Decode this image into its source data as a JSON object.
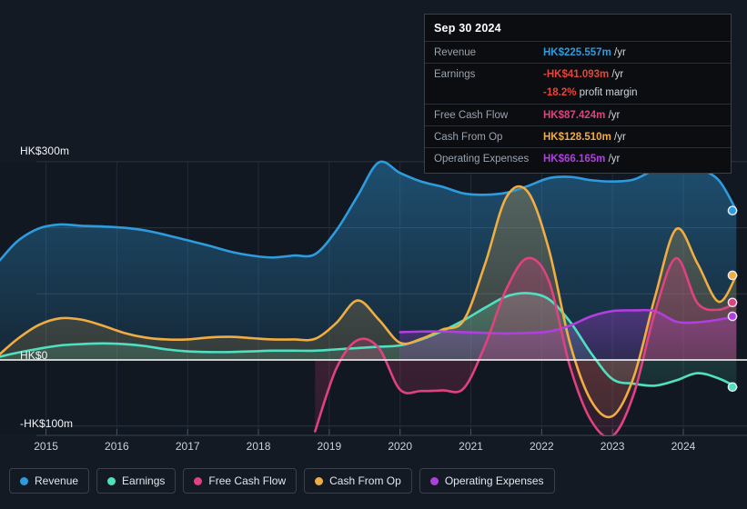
{
  "axes": {
    "y_labels": [
      {
        "text": "HK$300m",
        "value": 300
      },
      {
        "text": "HK$0",
        "value": 0
      },
      {
        "text": "-HK$100m",
        "value": -100
      }
    ],
    "x_labels": [
      "2015",
      "2016",
      "2017",
      "2018",
      "2019",
      "2020",
      "2021",
      "2022",
      "2023",
      "2024"
    ],
    "currency": "HK$",
    "unit": "m"
  },
  "tooltip": {
    "date": "Sep 30 2024",
    "rows": [
      {
        "label": "Revenue",
        "value": "HK$225.557m",
        "unit": "/yr",
        "color": "#2e9bdd"
      },
      {
        "label": "Earnings",
        "value": "-HK$41.093m",
        "unit": "/yr",
        "color": "#e8443a"
      },
      {
        "label": "",
        "value": "-18.2%",
        "unit": "profit margin",
        "color": "#e8443a",
        "sub": true
      },
      {
        "label": "Free Cash Flow",
        "value": "HK$87.424m",
        "unit": "/yr",
        "color": "#e0417f"
      },
      {
        "label": "Cash From Op",
        "value": "HK$128.510m",
        "unit": "/yr",
        "color": "#f0ad42"
      },
      {
        "label": "Operating Expenses",
        "value": "HK$66.165m",
        "unit": "/yr",
        "color": "#b13fe0"
      }
    ]
  },
  "legend": [
    {
      "label": "Revenue",
      "color": "#2e9bdd"
    },
    {
      "label": "Earnings",
      "color": "#4fe0c0"
    },
    {
      "label": "Free Cash Flow",
      "color": "#e0417f"
    },
    {
      "label": "Cash From Op",
      "color": "#f0ad42"
    },
    {
      "label": "Operating Expenses",
      "color": "#b13fe0"
    }
  ],
  "chart_data": {
    "type": "area",
    "title": "",
    "xlabel": "",
    "ylabel": "HK$ (millions)",
    "xlim": [
      2014.35,
      2024.9
    ],
    "ylim": [
      -120,
      320
    ],
    "ytick_values": [
      300,
      200,
      100,
      0,
      -100
    ],
    "grid": true,
    "legend_position": "bottom",
    "x": [
      2014.35,
      2014.6,
      2014.9,
      2015.2,
      2015.5,
      2015.8,
      2016.1,
      2016.4,
      2016.7,
      2017.0,
      2017.3,
      2017.6,
      2017.9,
      2018.2,
      2018.5,
      2018.8,
      2019.1,
      2019.4,
      2019.7,
      2020.0,
      2020.3,
      2020.6,
      2020.9,
      2021.2,
      2021.5,
      2021.8,
      2022.1,
      2022.4,
      2022.7,
      2023.0,
      2023.3,
      2023.6,
      2023.9,
      2024.2,
      2024.5,
      2024.75
    ],
    "series": [
      {
        "name": "Revenue",
        "color": "#2e9bdd",
        "values": [
          151,
          180,
          199,
          205,
          203,
          202,
          200,
          196,
          189,
          181,
          173,
          164,
          158,
          155,
          158,
          160,
          196,
          248,
          299,
          283,
          270,
          262,
          252,
          250,
          253,
          263,
          275,
          277,
          272,
          270,
          273,
          288,
          296,
          290,
          272,
          226
        ]
      },
      {
        "name": "Earnings",
        "color": "#4fe0c0",
        "values": [
          5,
          11,
          17,
          22,
          24,
          25,
          24,
          21,
          16,
          13,
          12,
          12,
          13,
          14,
          14,
          14,
          16,
          18,
          20,
          22,
          31,
          44,
          60,
          79,
          96,
          101,
          92,
          58,
          10,
          -29,
          -36,
          -39,
          -31,
          -20,
          -28,
          -41
        ]
      },
      {
        "name": "Free Cash Flow",
        "color": "#e0417f",
        "values": [
          null,
          null,
          null,
          null,
          null,
          null,
          null,
          null,
          null,
          null,
          null,
          null,
          null,
          null,
          null,
          -108,
          -13,
          30,
          18,
          -45,
          -47,
          -46,
          -43,
          22,
          107,
          154,
          120,
          -10,
          -92,
          -115,
          -52,
          72,
          154,
          86,
          76,
          87
        ]
      },
      {
        "name": "Cash From Op",
        "color": "#f0ad42",
        "values": [
          9,
          32,
          53,
          63,
          61,
          52,
          41,
          34,
          31,
          31,
          34,
          35,
          33,
          31,
          31,
          32,
          56,
          90,
          61,
          26,
          32,
          46,
          60,
          145,
          246,
          255,
          168,
          25,
          -62,
          -85,
          -26,
          95,
          198,
          146,
          88,
          128
        ]
      },
      {
        "name": "Operating Expenses",
        "color": "#b13fe0",
        "values": [
          null,
          null,
          null,
          null,
          null,
          null,
          null,
          null,
          null,
          null,
          null,
          null,
          null,
          null,
          null,
          null,
          null,
          null,
          null,
          42,
          43,
          43,
          42,
          41,
          40,
          41,
          43,
          52,
          66,
          74,
          75,
          74,
          58,
          57,
          61,
          66
        ]
      }
    ]
  }
}
